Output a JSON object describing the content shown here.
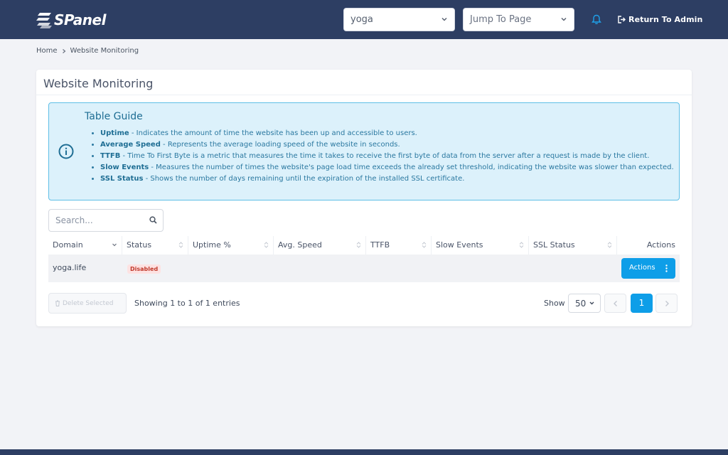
{
  "app": {
    "brand": "SPanel"
  },
  "header": {
    "user_select": "yoga",
    "jump_placeholder": "Jump To Page",
    "return_label": "Return To Admin"
  },
  "breadcrumb": {
    "home": "Home",
    "current": "Website Monitoring"
  },
  "page": {
    "title": "Website Monitoring"
  },
  "guide": {
    "title": "Table Guide",
    "items": [
      {
        "term": "Uptime",
        "desc": " - Indicates the amount of time the website has been up and accessible to users."
      },
      {
        "term": "Average Speed",
        "desc": " - Represents the average loading speed of the website in seconds."
      },
      {
        "term": "TTFB",
        "desc": " - Time To First Byte is a metric that measures the time it takes to receive the first byte of data from the server after a request is made by the client."
      },
      {
        "term": "Slow Events",
        "desc": " - Measures the number of times the website's page load time exceeds the already set threshold, indicating the website was slower than expected."
      },
      {
        "term": "SSL Status",
        "desc": " - Shows the number of days remaining until the expiration of the installed SSL certificate."
      }
    ]
  },
  "search": {
    "placeholder": "Search..."
  },
  "table": {
    "columns": [
      "Domain",
      "Status",
      "Uptime %",
      "Avg. Speed",
      "TTFB",
      "Slow Events",
      "SSL Status",
      "Actions"
    ],
    "rows": [
      {
        "domain": "yoga.life",
        "status": "Disabled",
        "action_label": "Actions"
      }
    ]
  },
  "footer": {
    "delete_label": "Delete Selected",
    "showing": "Showing 1 to 1 of 1 entries",
    "show_label": "Show",
    "page_size": "50",
    "current_page": "1"
  },
  "colors": {
    "topbar": "#2d3e63",
    "accent": "#0e9ee8",
    "info_bg": "#dcf1fb",
    "danger_badge": "#c0392b"
  }
}
